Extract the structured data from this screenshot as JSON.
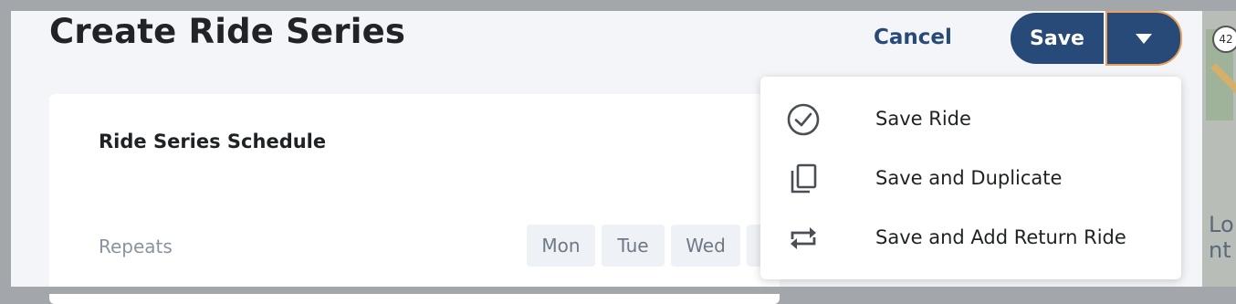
{
  "header": {
    "title": "Create Ride Series",
    "cancel_label": "Cancel",
    "save_label": "Save"
  },
  "schedule_card": {
    "title": "Ride Series Schedule",
    "repeats_label": "Repeats",
    "days": [
      "Mon",
      "Tue",
      "Wed"
    ]
  },
  "save_menu": {
    "items": [
      {
        "label": "Save Ride",
        "icon": "check-circle-icon"
      },
      {
        "label": "Save and Duplicate",
        "icon": "duplicate-icon"
      },
      {
        "label": "Save and Add Return Ride",
        "icon": "repeat-arrows-icon"
      }
    ]
  },
  "map": {
    "route_shield": "42",
    "partial_label_line1": "Lo",
    "partial_label_line2": "nt"
  },
  "colors": {
    "primary": "#274a78",
    "focus_outline": "#e8a25d",
    "background": "#f3f5f8"
  }
}
